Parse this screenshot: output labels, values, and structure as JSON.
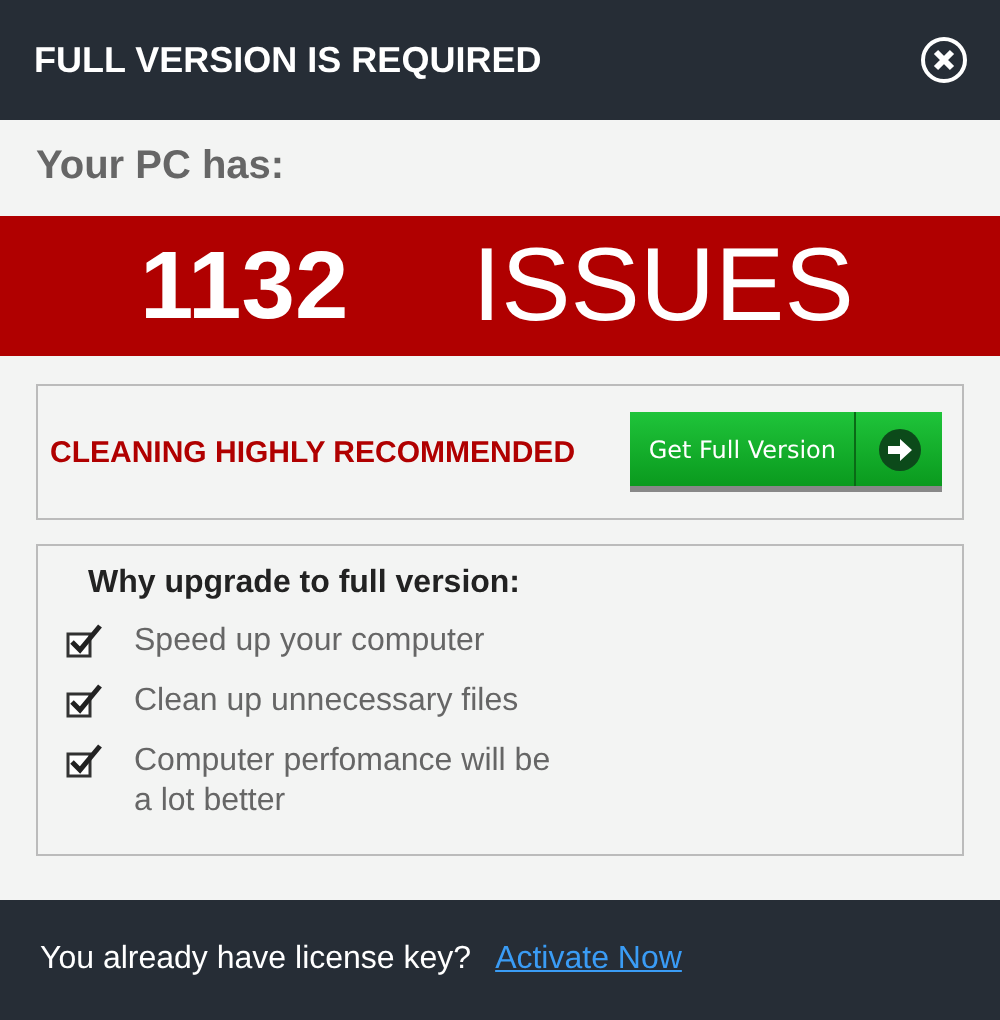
{
  "window": {
    "title": "FULL VERSION IS REQUIRED"
  },
  "status": {
    "intro": "Your PC has:",
    "count": "1132",
    "label": "ISSUES"
  },
  "recommendation": {
    "text": "CLEANING HIGHLY RECOMMENDED",
    "button": "Get Full Version"
  },
  "reasons": {
    "title": "Why upgrade to full version:",
    "items": [
      {
        "label": "Speed up your computer",
        "checked": true
      },
      {
        "label": "Clean up unnecessary files",
        "checked": true
      },
      {
        "label": "Computer perfomance will be a lot better",
        "checked": true
      }
    ]
  },
  "footer": {
    "text": "You already have license key?",
    "link": "Activate Now"
  }
}
